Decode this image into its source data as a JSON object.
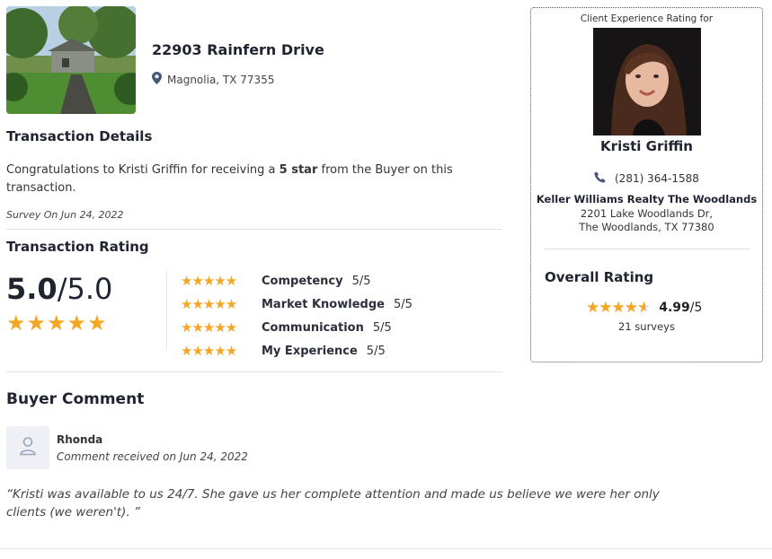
{
  "property": {
    "address": "22903 Rainfern Drive",
    "city": "Magnolia, TX 77355",
    "location_icon": "map-pin-icon"
  },
  "transaction_details": {
    "heading": "Transaction Details",
    "congrats_prefix": "Congratulations to Kristi Griffin for receiving a ",
    "congrats_bold": "5 star",
    "congrats_suffix": " from the Buyer on this transaction.",
    "survey_date": "Survey On Jun 24, 2022"
  },
  "transaction_rating": {
    "heading": "Transaction Rating",
    "score": "5.0",
    "out_of": "/5.0",
    "stars": 5,
    "categories": [
      {
        "name": "Competency",
        "score": "5/5",
        "stars": 5
      },
      {
        "name": "Market Knowledge",
        "score": "5/5",
        "stars": 5
      },
      {
        "name": "Communication",
        "score": "5/5",
        "stars": 5
      },
      {
        "name": "My Experience",
        "score": "5/5",
        "stars": 5
      }
    ]
  },
  "agent": {
    "card_label": "Client Experience Rating for",
    "name": "Kristi Griffin",
    "phone": "(281) 364-1588",
    "phone_icon": "phone-icon",
    "company": "Keller Williams Realty The Woodlands",
    "address_line1": "2201 Lake Woodlands Dr,",
    "address_line2": "The Woodlands, TX 77380"
  },
  "overall": {
    "heading": "Overall Rating",
    "score": "4.99",
    "out_of": "/5",
    "stars_fraction": 0.998,
    "surveys": "21 surveys"
  },
  "comment": {
    "heading": "Buyer Comment",
    "author": "Rhonda",
    "date": "Comment received on Jun 24, 2022",
    "text": "“Kristi was available to us 24/7. She gave us her complete attention and made us believe we were her only clients (we weren't). ”",
    "avatar_icon": "user-icon"
  },
  "colors": {
    "star": "#f5a623",
    "heading": "#1f2430"
  }
}
